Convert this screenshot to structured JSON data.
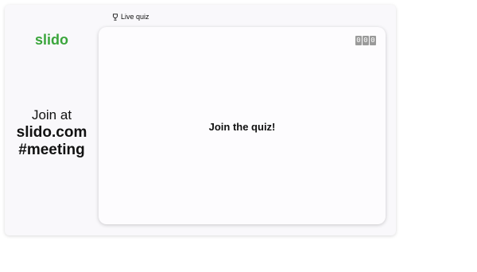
{
  "brand": {
    "logo_text": "slido",
    "logo_color": "#3aa53b"
  },
  "join": {
    "line1": "Join at",
    "line2": "slido.com",
    "line3": "#meeting"
  },
  "quiz": {
    "mode_label": "Live quiz",
    "mode_icon": "trophy-icon",
    "title": "Join the quiz!",
    "participant_counter": [
      "0",
      "0",
      "0"
    ]
  }
}
